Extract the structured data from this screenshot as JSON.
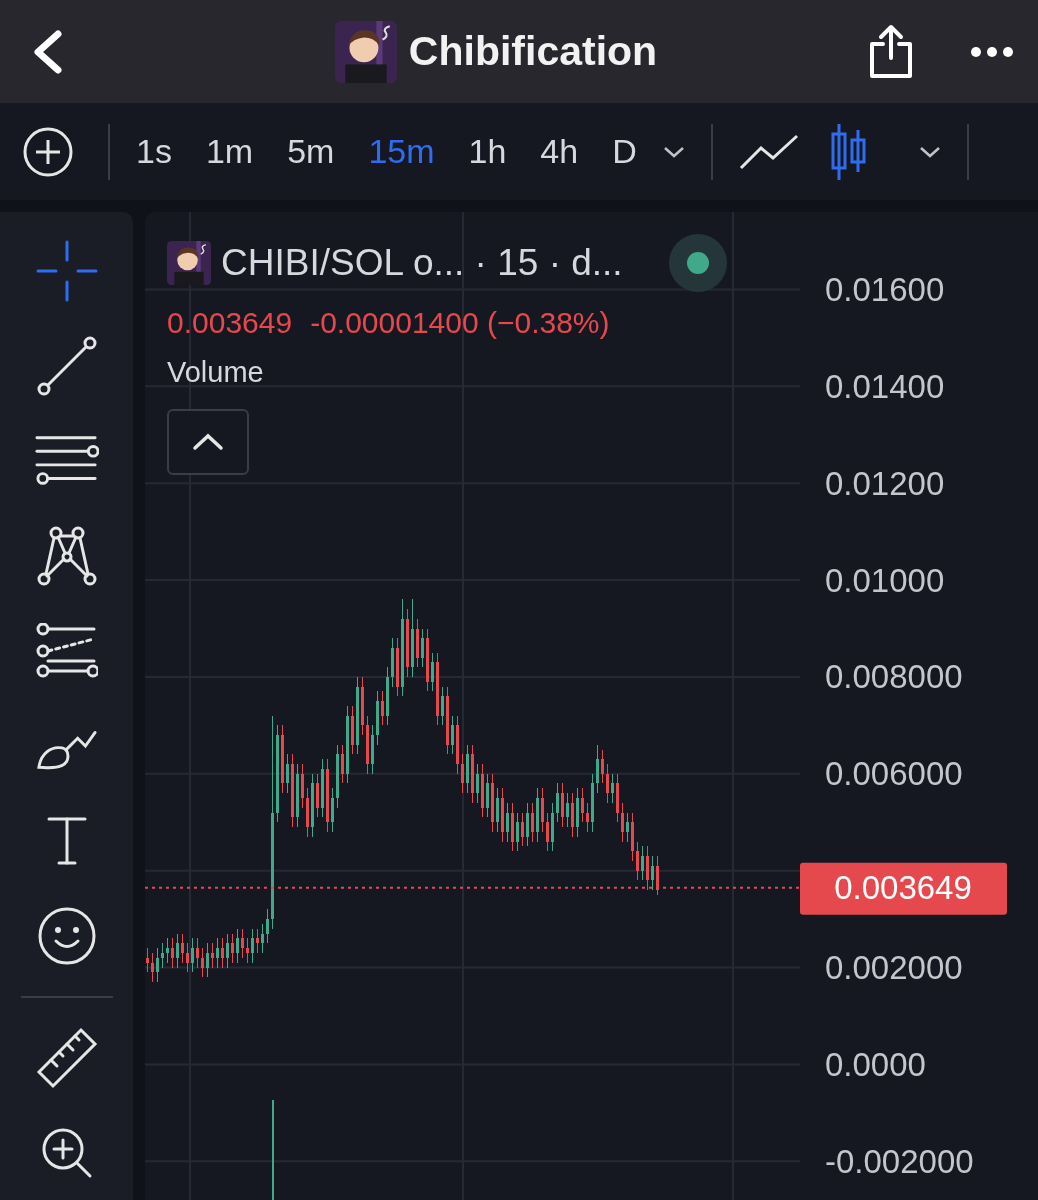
{
  "header": {
    "title": "Chibification"
  },
  "toolbar": {
    "intervals": [
      {
        "label": "1s",
        "selected": false
      },
      {
        "label": "1m",
        "selected": false
      },
      {
        "label": "5m",
        "selected": false
      },
      {
        "label": "15m",
        "selected": true
      },
      {
        "label": "1h",
        "selected": false
      },
      {
        "label": "4h",
        "selected": false
      },
      {
        "label": "D",
        "selected": false
      }
    ],
    "chart_types": [
      {
        "kind": "line",
        "selected": false
      },
      {
        "kind": "candles",
        "selected": true
      }
    ]
  },
  "drawing_tools": [
    {
      "kind": "crosshair",
      "selected": true
    },
    {
      "kind": "trend-line",
      "selected": false
    },
    {
      "kind": "horizontal-lines",
      "selected": false
    },
    {
      "kind": "pattern",
      "selected": false
    },
    {
      "kind": "projection",
      "selected": false
    },
    {
      "kind": "brush",
      "selected": false
    },
    {
      "kind": "text",
      "selected": false
    },
    {
      "kind": "emoji",
      "selected": false
    },
    {
      "kind": "ruler",
      "selected": false
    },
    {
      "kind": "zoom",
      "selected": false
    }
  ],
  "legend": {
    "symbol": "CHIBI/SOL o... · 15 · d...",
    "price": "0.003649",
    "change": "-0.00001400 (−0.38%)",
    "indicator": "Volume"
  },
  "chart": {
    "chart_data": {
      "type": "candlestick",
      "grid": true,
      "ylim": [
        -0.0028,
        0.0176
      ],
      "yticks": [
        {
          "value": 0.016,
          "label": "0.01600"
        },
        {
          "value": 0.014,
          "label": "0.01400"
        },
        {
          "value": 0.012,
          "label": "0.01200"
        },
        {
          "value": 0.01,
          "label": "0.01000"
        },
        {
          "value": 0.008,
          "label": "0.008000"
        },
        {
          "value": 0.006,
          "label": "0.006000"
        },
        {
          "value": 0.002,
          "label": "0.002000"
        },
        {
          "value": 0,
          "label": "0.0000"
        },
        {
          "value": -0.002,
          "label": "-0.002000"
        }
      ],
      "ref_lines": [
        {
          "axis": "y",
          "value": 0.003649,
          "label": "0.003649"
        }
      ],
      "categories": [
        null,
        null,
        null,
        null,
        null,
        null,
        null,
        null,
        null,
        null,
        null,
        null,
        null,
        null,
        null,
        null,
        null,
        null,
        null,
        null,
        null,
        null,
        null,
        null,
        null,
        null,
        null,
        null,
        null,
        null,
        null,
        null,
        null,
        null,
        null,
        null,
        null,
        null,
        null,
        null,
        null,
        null,
        null,
        null,
        null,
        null,
        null,
        null,
        null,
        null,
        null,
        null,
        null,
        null,
        null,
        null,
        null,
        null,
        null,
        null,
        null,
        null,
        null,
        null,
        null,
        null,
        null,
        null,
        null,
        null,
        null,
        null,
        null,
        null,
        null,
        null,
        null,
        null,
        null,
        null,
        null,
        null,
        null,
        null,
        null,
        null,
        null,
        null,
        null,
        null,
        null,
        null,
        null,
        null,
        null,
        null,
        null,
        null,
        null,
        null,
        null,
        null,
        null
      ],
      "ohlc": [
        [
          0.0022,
          0.0024,
          0.0019,
          0.0021
        ],
        [
          0.0021,
          0.0023,
          0.0017,
          0.0019
        ],
        [
          0.0019,
          0.0024,
          0.0017,
          0.0022
        ],
        [
          0.0022,
          0.0025,
          0.002,
          0.0023
        ],
        [
          0.0023,
          0.0026,
          0.0021,
          0.0024
        ],
        [
          0.0024,
          0.0026,
          0.002,
          0.0022
        ],
        [
          0.0022,
          0.0027,
          0.002,
          0.0025
        ],
        [
          0.0025,
          0.0027,
          0.0021,
          0.0023
        ],
        [
          0.0023,
          0.0025,
          0.0019,
          0.0021
        ],
        [
          0.0021,
          0.0026,
          0.0019,
          0.0024
        ],
        [
          0.0024,
          0.0026,
          0.002,
          0.0022
        ],
        [
          0.0022,
          0.0024,
          0.0018,
          0.002
        ],
        [
          0.002,
          0.0025,
          0.0018,
          0.0023
        ],
        [
          0.0023,
          0.0025,
          0.002,
          0.0022
        ],
        [
          0.0022,
          0.0026,
          0.002,
          0.0024
        ],
        [
          0.0024,
          0.0026,
          0.002,
          0.0022
        ],
        [
          0.0022,
          0.0027,
          0.002,
          0.0025
        ],
        [
          0.0025,
          0.0027,
          0.0021,
          0.0023
        ],
        [
          0.0023,
          0.0028,
          0.0021,
          0.0026
        ],
        [
          0.0026,
          0.0028,
          0.0022,
          0.0024
        ],
        [
          0.0024,
          0.0026,
          0.0021,
          0.0023
        ],
        [
          0.0023,
          0.0028,
          0.0021,
          0.0026
        ],
        [
          0.0026,
          0.0028,
          0.0023,
          0.0025
        ],
        [
          0.0025,
          0.0029,
          0.0023,
          0.0027
        ],
        [
          0.0027,
          0.0032,
          0.0025,
          0.003
        ],
        [
          0.003,
          0.0072,
          0.0028,
          0.0052
        ],
        [
          0.0052,
          0.007,
          0.005,
          0.0068
        ],
        [
          0.0068,
          0.007,
          0.0056,
          0.0058
        ],
        [
          0.0058,
          0.0064,
          0.0056,
          0.0062
        ],
        [
          0.0062,
          0.0064,
          0.0049,
          0.0051
        ],
        [
          0.0051,
          0.0062,
          0.0049,
          0.006
        ],
        [
          0.006,
          0.0062,
          0.0053,
          0.0055
        ],
        [
          0.0055,
          0.0057,
          0.0047,
          0.0049
        ],
        [
          0.0049,
          0.006,
          0.0047,
          0.0058
        ],
        [
          0.0058,
          0.006,
          0.0051,
          0.0053
        ],
        [
          0.0053,
          0.0063,
          0.0051,
          0.0061
        ],
        [
          0.0061,
          0.0063,
          0.0048,
          0.005
        ],
        [
          0.005,
          0.0057,
          0.0048,
          0.0055
        ],
        [
          0.0055,
          0.0066,
          0.0053,
          0.0064
        ],
        [
          0.0064,
          0.0066,
          0.0058,
          0.006
        ],
        [
          0.006,
          0.0074,
          0.0058,
          0.0072
        ],
        [
          0.0072,
          0.0074,
          0.0064,
          0.0066
        ],
        [
          0.0066,
          0.008,
          0.0064,
          0.0078
        ],
        [
          0.0078,
          0.008,
          0.0068,
          0.007
        ],
        [
          0.007,
          0.0072,
          0.006,
          0.0062
        ],
        [
          0.0062,
          0.007,
          0.006,
          0.0068
        ],
        [
          0.0068,
          0.0077,
          0.0066,
          0.0075
        ],
        [
          0.0075,
          0.0077,
          0.007,
          0.0072
        ],
        [
          0.0072,
          0.0082,
          0.007,
          0.008
        ],
        [
          0.008,
          0.0088,
          0.0078,
          0.0086
        ],
        [
          0.0086,
          0.0088,
          0.0076,
          0.0078
        ],
        [
          0.0078,
          0.0096,
          0.0076,
          0.0092
        ],
        [
          0.0092,
          0.0094,
          0.008,
          0.0082
        ],
        [
          0.0082,
          0.0096,
          0.008,
          0.009
        ],
        [
          0.009,
          0.0092,
          0.0082,
          0.0084
        ],
        [
          0.0084,
          0.009,
          0.0082,
          0.0088
        ],
        [
          0.0088,
          0.009,
          0.0077,
          0.0079
        ],
        [
          0.0079,
          0.0085,
          0.0077,
          0.0083
        ],
        [
          0.0083,
          0.0085,
          0.007,
          0.0072
        ],
        [
          0.0072,
          0.0078,
          0.007,
          0.0076
        ],
        [
          0.0076,
          0.0078,
          0.0064,
          0.0066
        ],
        [
          0.0066,
          0.0072,
          0.0064,
          0.007
        ],
        [
          0.007,
          0.0072,
          0.006,
          0.0062
        ],
        [
          0.0062,
          0.0064,
          0.0056,
          0.0058
        ],
        [
          0.0058,
          0.0066,
          0.0056,
          0.0064
        ],
        [
          0.0064,
          0.0066,
          0.0054,
          0.0056
        ],
        [
          0.0056,
          0.0062,
          0.0054,
          0.006
        ],
        [
          0.006,
          0.0062,
          0.0051,
          0.0053
        ],
        [
          0.0053,
          0.006,
          0.0051,
          0.0058
        ],
        [
          0.0058,
          0.006,
          0.0048,
          0.005
        ],
        [
          0.005,
          0.0057,
          0.0048,
          0.0055
        ],
        [
          0.0055,
          0.0057,
          0.0046,
          0.0048
        ],
        [
          0.0048,
          0.0054,
          0.0046,
          0.0052
        ],
        [
          0.0052,
          0.0054,
          0.0044,
          0.0046
        ],
        [
          0.0046,
          0.0052,
          0.0044,
          0.005
        ],
        [
          0.005,
          0.0052,
          0.0045,
          0.0047
        ],
        [
          0.0047,
          0.0054,
          0.0045,
          0.0052
        ],
        [
          0.0052,
          0.0054,
          0.0046,
          0.0048
        ],
        [
          0.0048,
          0.0057,
          0.0046,
          0.0055
        ],
        [
          0.0055,
          0.0057,
          0.0048,
          0.005
        ],
        [
          0.005,
          0.0052,
          0.0044,
          0.0046
        ],
        [
          0.0046,
          0.0054,
          0.0044,
          0.0052
        ],
        [
          0.0052,
          0.0058,
          0.005,
          0.0056
        ],
        [
          0.0056,
          0.0058,
          0.0049,
          0.0051
        ],
        [
          0.0051,
          0.0056,
          0.0049,
          0.0054
        ],
        [
          0.0054,
          0.0056,
          0.0047,
          0.0049
        ],
        [
          0.0049,
          0.0057,
          0.0047,
          0.0055
        ],
        [
          0.0055,
          0.0057,
          0.005,
          0.0052
        ],
        [
          0.0052,
          0.0054,
          0.0048,
          0.005
        ],
        [
          0.005,
          0.006,
          0.0048,
          0.0058
        ],
        [
          0.0058,
          0.0066,
          0.0056,
          0.0063
        ],
        [
          0.0063,
          0.0065,
          0.0058,
          0.006
        ],
        [
          0.006,
          0.0062,
          0.0054,
          0.0056
        ],
        [
          0.0056,
          0.006,
          0.0054,
          0.0058
        ],
        [
          0.0058,
          0.006,
          0.005,
          0.0052
        ],
        [
          0.0052,
          0.0054,
          0.0046,
          0.0048
        ],
        [
          0.0048,
          0.0052,
          0.0046,
          0.005
        ],
        [
          0.005,
          0.0052,
          0.0042,
          0.0044
        ],
        [
          0.0044,
          0.0046,
          0.0038,
          0.004
        ],
        [
          0.004,
          0.0045,
          0.0038,
          0.0043
        ],
        [
          0.0043,
          0.0045,
          0.0036,
          0.0038
        ],
        [
          0.0038,
          0.0043,
          0.0036,
          0.0041
        ],
        [
          0.0041,
          0.0043,
          0.0035,
          0.0036
        ]
      ]
    }
  }
}
